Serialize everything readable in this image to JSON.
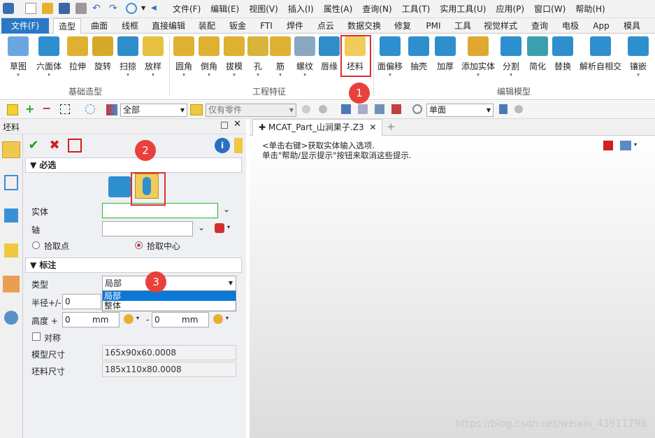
{
  "menubar": [
    "文件(F)",
    "编辑(E)",
    "视图(V)",
    "插入(I)",
    "属性(A)",
    "查询(N)",
    "工具(T)",
    "实用工具(U)",
    "应用(P)",
    "窗口(W)",
    "帮助(H)"
  ],
  "tabs": [
    "文件(F)",
    "造型",
    "曲面",
    "线框",
    "直接编辑",
    "装配",
    "钣金",
    "FTI",
    "焊件",
    "点云",
    "数据交换",
    "修复",
    "PMI",
    "工具",
    "视觉样式",
    "查询",
    "电极",
    "App",
    "模具"
  ],
  "ribbon": {
    "basic": [
      "草图",
      "六面体",
      "拉伸",
      "旋转",
      "扫掠",
      "放样"
    ],
    "engineering": [
      "圆角",
      "倒角",
      "拔模",
      "孔",
      "筋",
      "螺纹",
      "唇缘",
      "坯料"
    ],
    "edit": [
      "面偏移",
      "抽壳",
      "加厚",
      "添加实体",
      "分割",
      "简化",
      "替换",
      "解析自相交",
      "镶嵌"
    ],
    "groups": [
      "基础造型",
      "工程特征",
      "编辑模型"
    ]
  },
  "toolbar": {
    "filter_all": "全部",
    "parts_only": "仅有零件",
    "view": "单面"
  },
  "panel": {
    "title": "坯料",
    "required": "必选",
    "solid_label": "实体",
    "axis_label": "轴",
    "pick_point": "拾取点",
    "pick_center": "拾取中心",
    "annotation": "标注",
    "type_label": "类型",
    "type_value": "局部",
    "options": [
      "局部",
      "整体"
    ],
    "radius_label": "半径+/-",
    "radius_value": "0",
    "height_label": "高度 +",
    "height_plus": "0",
    "height_minus": "0",
    "unit": "mm",
    "symmetric": "对称",
    "model_size_label": "模型尺寸",
    "model_size": "165x90x60.0008",
    "blank_size_label": "坯料尺寸",
    "blank_size": "185x110x80.0008"
  },
  "doc": {
    "tab": "MCAT_Part_山涧果子.Z3",
    "hint1": "<单击右键>获取实体输入选项.",
    "hint2": "单击\"帮助/显示提示\"按钮来取消这些提示."
  },
  "callouts": [
    "1",
    "2",
    "3"
  ],
  "watermark": "https://blog.csdn.net/weixin_43911798",
  "colors": {
    "file_tab": "#2b78c6",
    "callout": "#e8403a",
    "accent": "#3a8fd8"
  }
}
